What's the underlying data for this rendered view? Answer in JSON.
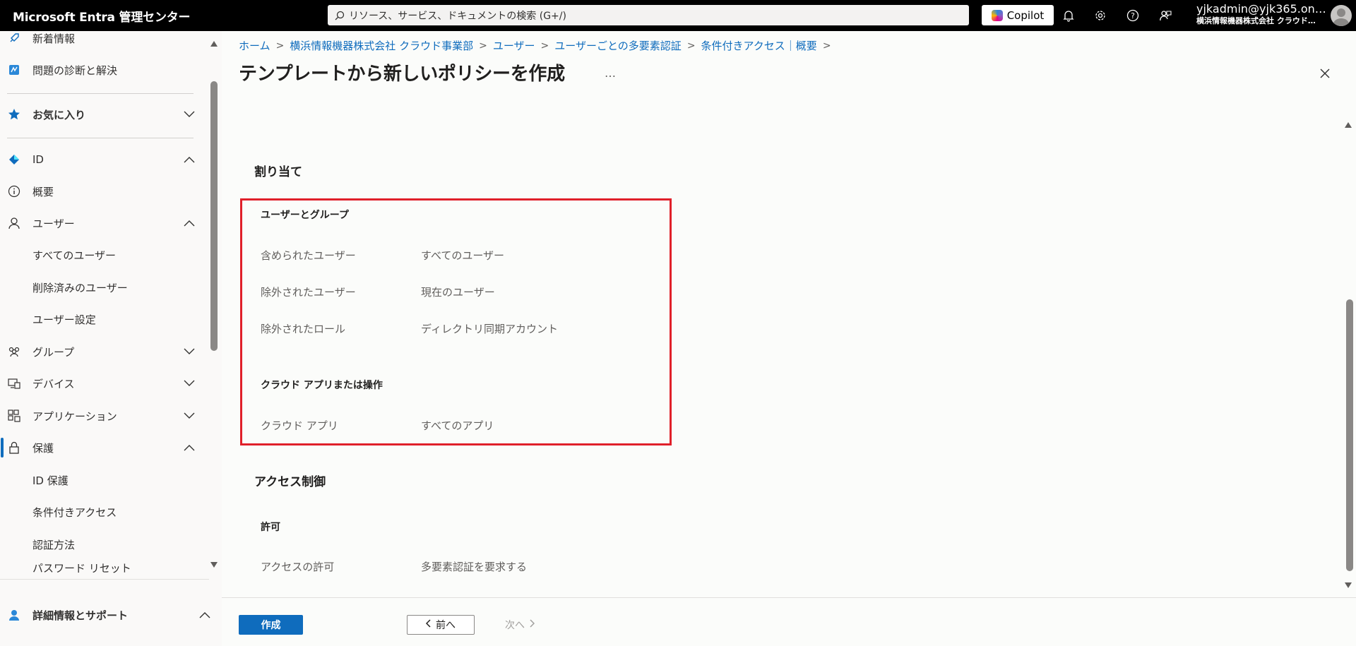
{
  "topbar": {
    "app_title": "Microsoft Entra 管理センター",
    "search_placeholder": "リソース、サービス、ドキュメントの検索 (G+/)",
    "copilot_label": "Copilot",
    "user_name": "yjkadmin@yjk365.on…",
    "user_org": "横浜情報機器株式会社 クラウド…"
  },
  "sidebar": {
    "items": [
      {
        "label": "新着情報",
        "icon": "rocket-icon"
      },
      {
        "label": "問題の診断と解決",
        "icon": "diagnose-icon"
      },
      {
        "label": "お気に入り",
        "icon": "star-icon"
      },
      {
        "label": "ID",
        "icon": "identity-diamond-icon"
      },
      {
        "label": "概要",
        "icon": "info-icon"
      },
      {
        "label": "ユーザー",
        "icon": "user-icon"
      },
      {
        "label": "すべてのユーザー"
      },
      {
        "label": "削除済みのユーザー"
      },
      {
        "label": "ユーザー設定"
      },
      {
        "label": "グループ",
        "icon": "group-icon"
      },
      {
        "label": "デバイス",
        "icon": "devices-icon"
      },
      {
        "label": "アプリケーション",
        "icon": "applications-icon"
      },
      {
        "label": "保護",
        "icon": "lock-icon"
      },
      {
        "label": "ID 保護"
      },
      {
        "label": "条件付きアクセス"
      },
      {
        "label": "認証方法"
      },
      {
        "label": "パスワード リセット"
      },
      {
        "label": "詳細情報とサポート",
        "icon": "support-icon"
      }
    ],
    "collapse_label": "«"
  },
  "breadcrumb": [
    "ホーム",
    "横浜情報機器株式会社 クラウド事業部",
    "ユーザー",
    "ユーザーごとの多要素認証",
    "条件付きアクセス｜概要"
  ],
  "page": {
    "title": "テンプレートから新しいポリシーを作成",
    "more": "…"
  },
  "assignments": {
    "title": "割り当て",
    "users_groups_title": "ユーザーとグループ",
    "rows": [
      {
        "label": "含められたユーザー",
        "value": "すべてのユーザー"
      },
      {
        "label": "除外されたユーザー",
        "value": "現在のユーザー"
      },
      {
        "label": "除外されたロール",
        "value": "ディレクトリ同期アカウント"
      }
    ],
    "cloud_apps_title": "クラウド アプリまたは操作",
    "cloud_row": {
      "label": "クラウド アプリ",
      "value": "すべてのアプリ"
    }
  },
  "access_control": {
    "title": "アクセス制御",
    "grant_title": "許可",
    "row": {
      "label": "アクセスの許可",
      "value": "多要素認証を要求する"
    }
  },
  "footer": {
    "create": "作成",
    "prev": "前へ",
    "next": "次へ"
  },
  "colors": {
    "accent": "#0f6cbd",
    "highlight": "#e0202a",
    "topbar": "#000000"
  }
}
